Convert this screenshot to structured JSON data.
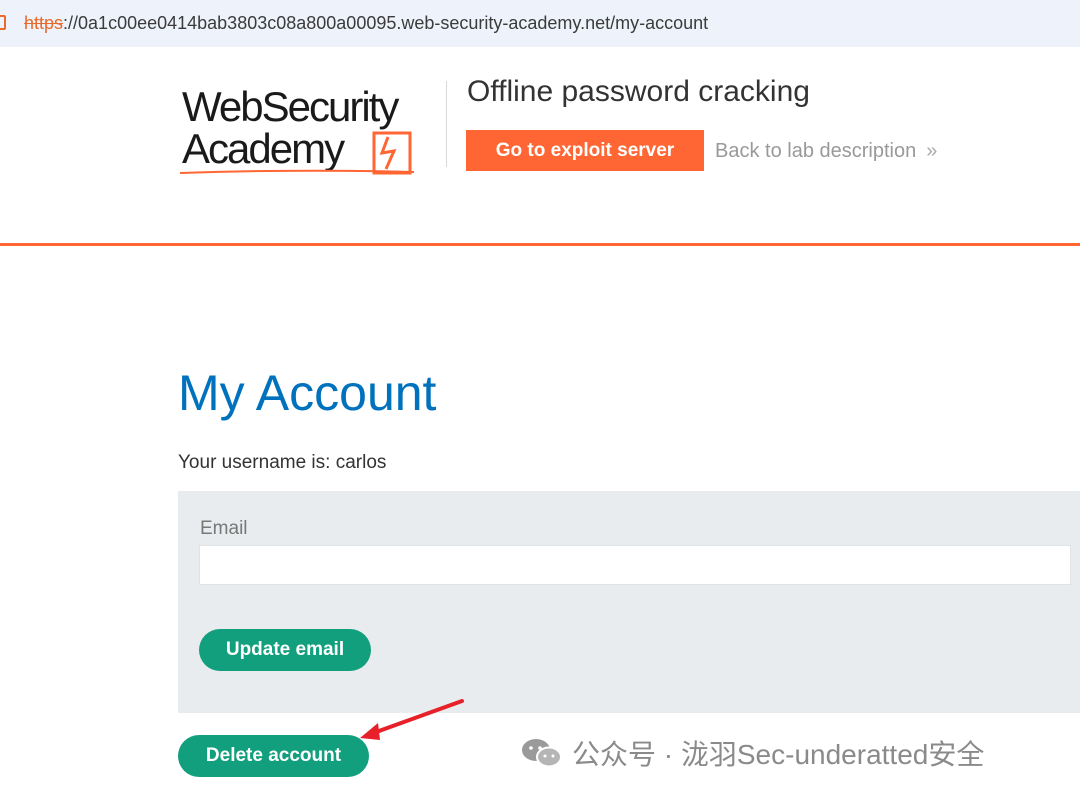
{
  "browser": {
    "url_scheme": "https",
    "url_rest": "://0a1c00ee0414bab3803c08a800a00095.web-security-academy.net/my-account"
  },
  "header": {
    "logo_line1": "WebSecurity",
    "logo_line2": "Academy",
    "lab_title": "Offline password cracking",
    "exploit_button": "Go to exploit server",
    "back_link": "Back to lab description",
    "back_chevrons": "»",
    "accent_color": "#ff6633"
  },
  "main": {
    "title": "My Account",
    "username_line": "Your username is: carlos",
    "email_label": "Email",
    "email_value": "",
    "update_button": "Update email",
    "delete_button": "Delete account",
    "title_color": "#0071bc",
    "button_color": "#129f7e"
  },
  "watermark": {
    "text": "公众号 · 泷羽Sec-underatted安全",
    "icon": "wechat-icon"
  },
  "annotation": {
    "icon": "red-arrow-icon"
  }
}
